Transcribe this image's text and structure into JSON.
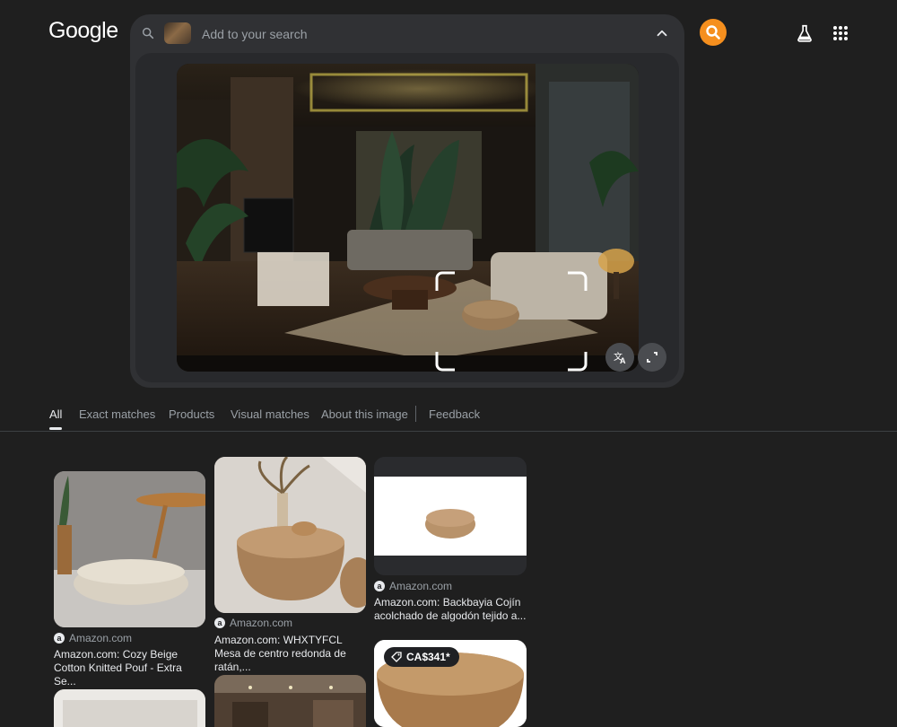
{
  "header": {
    "logo": "Google",
    "search": {
      "placeholder": "Add to your search"
    }
  },
  "icons": {
    "search": "search-icon",
    "chevron": "chevron-up-icon",
    "translate": "translate-icon",
    "expand": "expand-icon",
    "labs": "flask-icon",
    "apps": "apps-grid-icon"
  },
  "colors": {
    "accent": "#f58f1e",
    "background": "#1f1f1f",
    "panel": "#303134"
  },
  "tabs": [
    {
      "label": "All",
      "active": true
    },
    {
      "label": "Exact matches"
    },
    {
      "label": "Products"
    },
    {
      "label": "Visual matches"
    },
    {
      "label": "About this image"
    },
    {
      "label": "Feedback"
    }
  ],
  "results": [
    {
      "source": "Amazon.com",
      "title": "Amazon.com: Cozy Beige Cotton Knitted Pouf - Extra Se..."
    },
    {
      "source": "Amazon.com",
      "title": "Amazon.com: WHXTYFCL Mesa de centro redonda de ratán,..."
    },
    {
      "source": "Amazon.com",
      "title": "Amazon.com: Backbayia Cojín acolchado de algodón tejido a..."
    },
    {
      "price": "CA$341*"
    }
  ]
}
